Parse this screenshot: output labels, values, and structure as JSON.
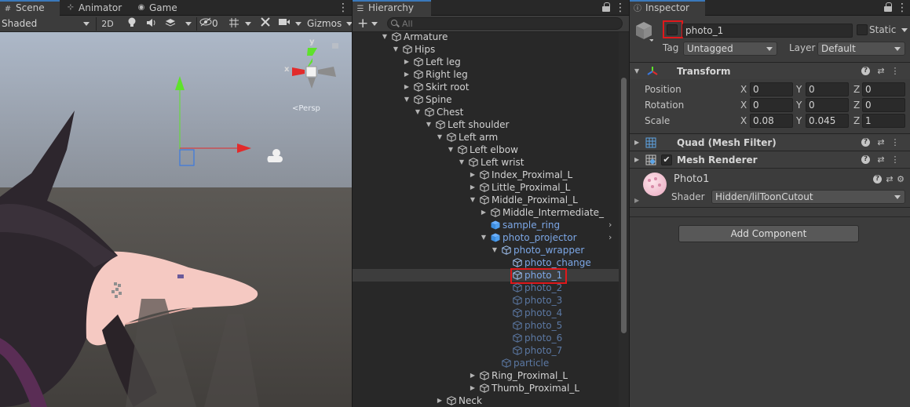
{
  "scene": {
    "tabs": [
      {
        "label": "Scene",
        "icon": "grid-icon"
      },
      {
        "label": "Animator",
        "icon": "animator-icon"
      },
      {
        "label": "Game",
        "icon": "gamepad-icon"
      }
    ],
    "toolbar": {
      "shading_mode": "Shaded",
      "mode_2d": "2D",
      "hidden_count": "0",
      "gizmos": "Gizmos"
    },
    "gizmo": {
      "axis_y": "y",
      "axis_x": "x",
      "persp_label": "<Persp"
    }
  },
  "hierarchy": {
    "tab_label": "Hierarchy",
    "add_label": "+",
    "search_placeholder": "All",
    "rows": [
      {
        "label": "Armature",
        "indent": 3,
        "expanded": true,
        "kind": "normal"
      },
      {
        "label": "Hips",
        "indent": 4,
        "expanded": true,
        "kind": "normal"
      },
      {
        "label": "Left leg",
        "indent": 5,
        "expanded": false,
        "kind": "normal"
      },
      {
        "label": "Right leg",
        "indent": 5,
        "expanded": false,
        "kind": "normal"
      },
      {
        "label": "Skirt root",
        "indent": 5,
        "expanded": false,
        "kind": "normal"
      },
      {
        "label": "Spine",
        "indent": 5,
        "expanded": true,
        "kind": "normal"
      },
      {
        "label": "Chest",
        "indent": 6,
        "expanded": true,
        "kind": "normal"
      },
      {
        "label": "Left shoulder",
        "indent": 7,
        "expanded": true,
        "kind": "normal"
      },
      {
        "label": "Left arm",
        "indent": 8,
        "expanded": true,
        "kind": "normal"
      },
      {
        "label": "Left elbow",
        "indent": 9,
        "expanded": true,
        "kind": "normal"
      },
      {
        "label": "Left wrist",
        "indent": 10,
        "expanded": true,
        "kind": "normal"
      },
      {
        "label": "Index_Proximal_L",
        "indent": 11,
        "expanded": false,
        "kind": "normal"
      },
      {
        "label": "Little_Proximal_L",
        "indent": 11,
        "expanded": false,
        "kind": "normal"
      },
      {
        "label": "Middle_Proximal_L",
        "indent": 11,
        "expanded": true,
        "kind": "normal"
      },
      {
        "label": "Middle_Intermediate_",
        "indent": 12,
        "expanded": false,
        "kind": "normal"
      },
      {
        "label": "sample_ring",
        "indent": 12,
        "expanded": null,
        "kind": "prefab-root",
        "more": true
      },
      {
        "label": "photo_projector",
        "indent": 12,
        "expanded": true,
        "kind": "prefab-root",
        "more": true
      },
      {
        "label": "photo_wrapper",
        "indent": 13,
        "expanded": true,
        "kind": "prefab"
      },
      {
        "label": "photo_change",
        "indent": 14,
        "expanded": null,
        "kind": "prefab"
      },
      {
        "label": "photo_1",
        "indent": 14,
        "expanded": null,
        "kind": "prefab",
        "selected": true
      },
      {
        "label": "photo_2",
        "indent": 14,
        "expanded": null,
        "kind": "prefab-disabled"
      },
      {
        "label": "photo_3",
        "indent": 14,
        "expanded": null,
        "kind": "prefab-disabled"
      },
      {
        "label": "photo_4",
        "indent": 14,
        "expanded": null,
        "kind": "prefab-disabled"
      },
      {
        "label": "photo_5",
        "indent": 14,
        "expanded": null,
        "kind": "prefab-disabled"
      },
      {
        "label": "photo_6",
        "indent": 14,
        "expanded": null,
        "kind": "prefab-disabled"
      },
      {
        "label": "photo_7",
        "indent": 14,
        "expanded": null,
        "kind": "prefab-disabled"
      },
      {
        "label": "particle",
        "indent": 13,
        "expanded": null,
        "kind": "prefab-disabled"
      },
      {
        "label": "Ring_Proximal_L",
        "indent": 11,
        "expanded": false,
        "kind": "normal"
      },
      {
        "label": "Thumb_Proximal_L",
        "indent": 11,
        "expanded": false,
        "kind": "normal"
      },
      {
        "label": "Neck",
        "indent": 8,
        "expanded": false,
        "kind": "normal"
      }
    ]
  },
  "inspector": {
    "tab_label": "Inspector",
    "object_name": "photo_1",
    "active": false,
    "static_label": "Static",
    "tag_label": "Tag",
    "tag_value": "Untagged",
    "layer_label": "Layer",
    "layer_value": "Default",
    "transform": {
      "title": "Transform",
      "position_label": "Position",
      "rotation_label": "Rotation",
      "scale_label": "Scale",
      "axis_x": "X",
      "axis_y": "Y",
      "axis_z": "Z",
      "position": [
        "0",
        "0",
        "0"
      ],
      "rotation": [
        "0",
        "0",
        "0"
      ],
      "scale": [
        "0.08",
        "0.045",
        "1"
      ]
    },
    "mesh_filter_title": "Quad (Mesh Filter)",
    "mesh_renderer_title": "Mesh Renderer",
    "mesh_renderer_enabled": true,
    "material_name": "Photo1",
    "shader_label": "Shader",
    "shader_value": "Hidden/lilToonCutout",
    "add_component": "Add Component"
  },
  "colors": {
    "accent_blue": "#3a79bb",
    "highlight_red": "#e0181b",
    "prefab_blue": "#7ca7e6",
    "prefab_disabled": "#5b78a3",
    "gizmo_x": "#e22b2b",
    "gizmo_y": "#5ee22b",
    "gizmo_z": "#3a79e0"
  }
}
